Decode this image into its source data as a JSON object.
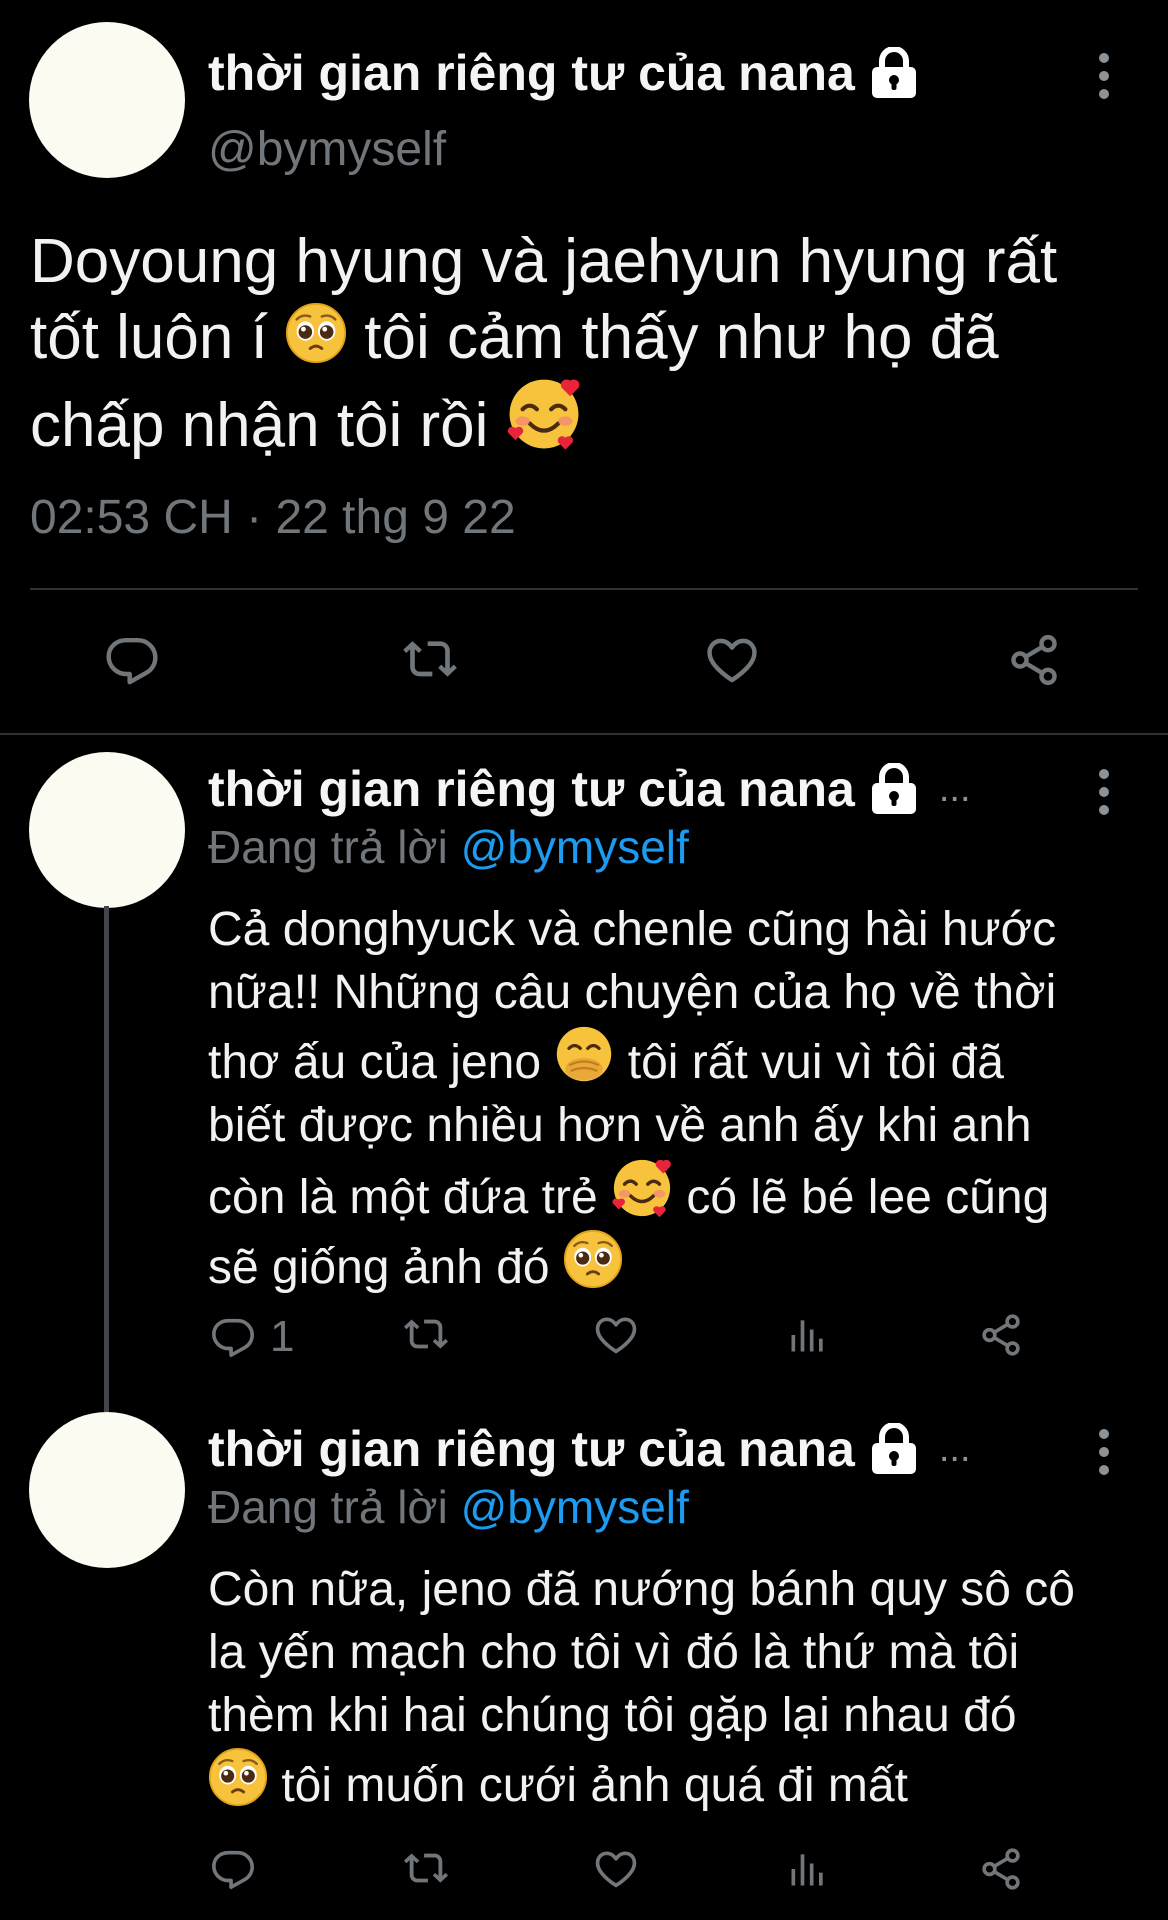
{
  "main_tweet": {
    "display_name": "thời gian riêng tư của nana",
    "handle": "@bymyself",
    "text_line1": "Doyoung hyung và jaehyun hyung rất",
    "text_line2a": "tốt luôn í",
    "text_line2b": "tôi cảm thấy như họ đã",
    "text_line3": "chấp nhận tôi rồi",
    "timestamp": "02:53 CH · 22 thg 9 22"
  },
  "replies": [
    {
      "display_name": "thời gian riêng tư của nana",
      "ellipsis": "...",
      "replying_label": "Đang trả lời",
      "replying_to": "@bymyself",
      "line1": "Cả donghyuck và chenle cũng hài hước",
      "line2": "nữa!! Những câu chuyện của họ về thời",
      "line3a": "thơ ấu của jeno",
      "line3b": "tôi rất vui vì tôi đã",
      "line4": "biết được nhiều hơn về anh ấy khi anh",
      "line5a": "còn là một đứa trẻ",
      "line5b": "có lẽ bé lee cũng",
      "line6a": "sẽ giống ảnh đó",
      "reply_count": "1"
    },
    {
      "display_name": "thời gian riêng tư của nana",
      "ellipsis": "...",
      "replying_label": "Đang trả lời",
      "replying_to": "@bymyself",
      "line1": "Còn nữa, jeno đã nướng bánh quy sô cô",
      "line2": "la yến mạch cho tôi vì đó là thứ mà tôi",
      "line3": "thèm khi hai chúng tôi gặp lại nhau đó",
      "line4b": "tôi muốn cưới ảnh quá đi mất"
    }
  ],
  "icons": {
    "lock": "lock-icon",
    "more": "more-vertical-icon",
    "reply": "reply-icon",
    "retweet": "retweet-icon",
    "like": "heart-icon",
    "share": "share-icon",
    "analytics": "analytics-icon",
    "pleading": "pleading-face-emoji",
    "hearts": "smiling-face-with-hearts-emoji",
    "giggle": "face-with-hand-over-mouth-emoji"
  },
  "colors": {
    "background": "#000000",
    "text": "#f2f2f2",
    "muted": "#71767b",
    "link": "#1d9bf0",
    "avatar": "#fbfbf1"
  }
}
